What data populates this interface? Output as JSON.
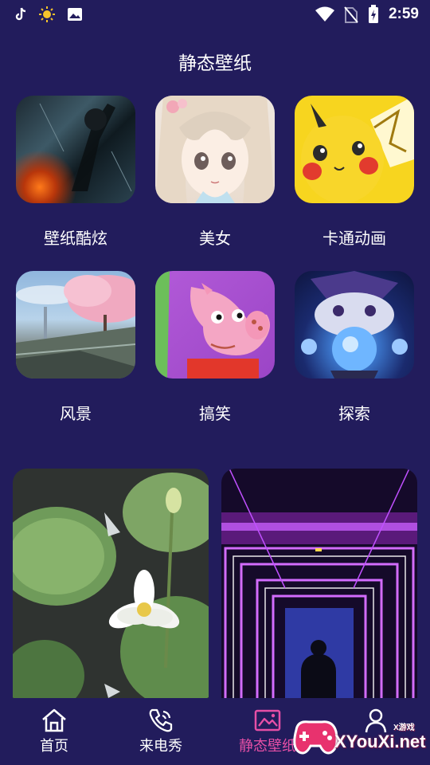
{
  "status_bar": {
    "left_icons": [
      "tiktok-icon",
      "sun-icon",
      "image-icon"
    ],
    "right_icons": [
      "wifi-icon",
      "no-sim-icon",
      "battery-charging-icon"
    ],
    "time": "2:59"
  },
  "page": {
    "title": "静态壁纸"
  },
  "categories": [
    {
      "label": "壁纸酷炫",
      "image": "dark-city-scene"
    },
    {
      "label": "美女",
      "image": "anime-girl"
    },
    {
      "label": "卡通动画",
      "image": "pikachu"
    },
    {
      "label": "风景",
      "image": "cherry-blossom-landscape"
    },
    {
      "label": "搞笑",
      "image": "peppa-pig"
    },
    {
      "label": "探索",
      "image": "wizard-cat-crystal-ball"
    }
  ],
  "featured_cards": [
    {
      "image": "lotus-flowers"
    },
    {
      "image": "neon-tunnel"
    }
  ],
  "bottom_nav": {
    "items": [
      {
        "label": "首页",
        "icon": "home-icon"
      },
      {
        "label": "来电秀",
        "icon": "phone-call-icon"
      },
      {
        "label": "静态壁纸",
        "icon": "gallery-icon",
        "active": true
      },
      {
        "label": "",
        "icon": "person-icon"
      }
    ],
    "active_color": "#e64fa6"
  },
  "watermark": {
    "text": "XYouXi.net",
    "small": "X游戏"
  },
  "colors": {
    "background": "#221c5c",
    "text": "#ffffff",
    "accent": "#e64fa6"
  }
}
